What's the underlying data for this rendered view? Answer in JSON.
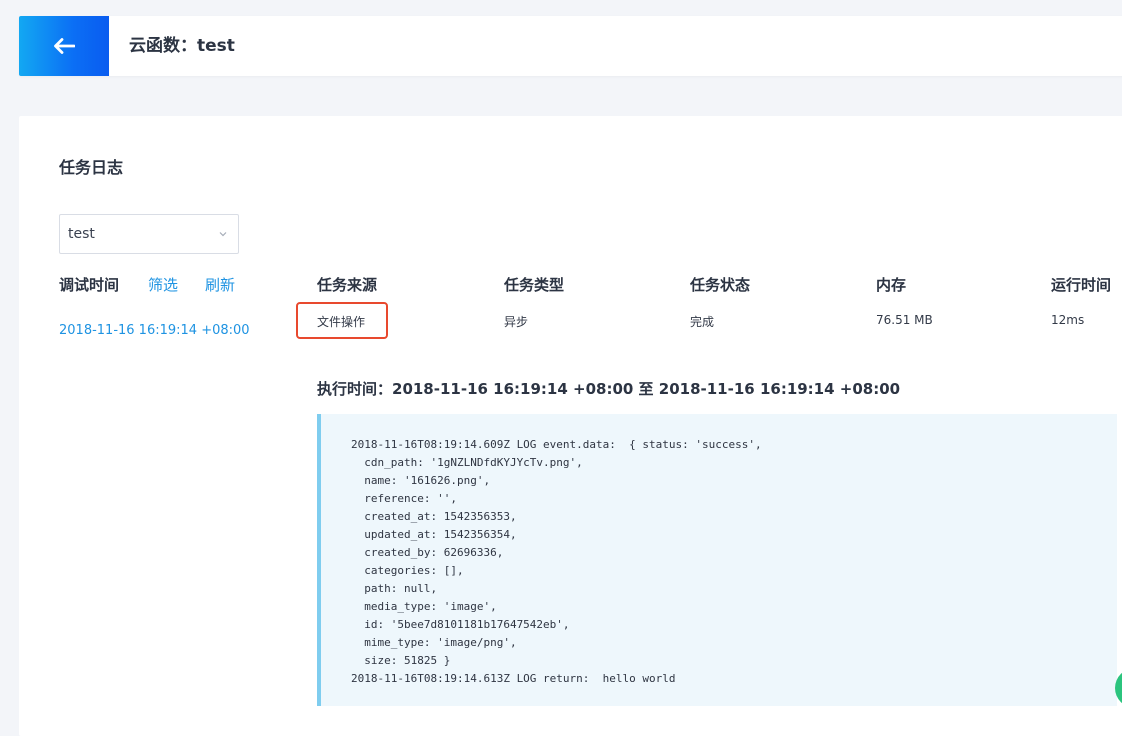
{
  "header": {
    "title": "云函数：test"
  },
  "task_log": {
    "section_title": "任务日志",
    "function_select": {
      "value": "test"
    },
    "debug_time_label": "调试时间",
    "filter_label": "筛选",
    "refresh_label": "刷新",
    "debug_entries": [
      "2018-11-16 16:19:14 +08:00"
    ],
    "columns": [
      {
        "header": "任务来源",
        "value": "文件操作"
      },
      {
        "header": "任务类型",
        "value": "异步"
      },
      {
        "header": "任务状态",
        "value": "完成"
      },
      {
        "header": "内存",
        "value": "76.51 MB"
      },
      {
        "header": "运行时间",
        "value": "12ms"
      }
    ],
    "exec_time": "执行时间：2018-11-16 16:19:14 +08:00 至 2018-11-16 16:19:14 +08:00",
    "log_text": "2018-11-16T08:19:14.609Z LOG event.data:  { status: 'success',\n  cdn_path: '1gNZLNDfdKYJYcTv.png',\n  name: '161626.png',\n  reference: '',\n  created_at: 1542356353,\n  updated_at: 1542356354,\n  created_by: 62696336,\n  categories: [],\n  path: null,\n  media_type: 'image',\n  id: '5bee7d8101181b17647542eb',\n  mime_type: 'image/png',\n  size: 51825 }\n2018-11-16T08:19:14.613Z LOG return:  hello world"
  },
  "colors": {
    "accent": "#1e93e2",
    "highlight_border": "#e8492e",
    "log_border": "#7fcdef",
    "log_background": "#eef7fc"
  },
  "icons": {
    "back": "arrow-left-icon",
    "select": "chevron-down-icon",
    "fab": "circle-icon"
  }
}
